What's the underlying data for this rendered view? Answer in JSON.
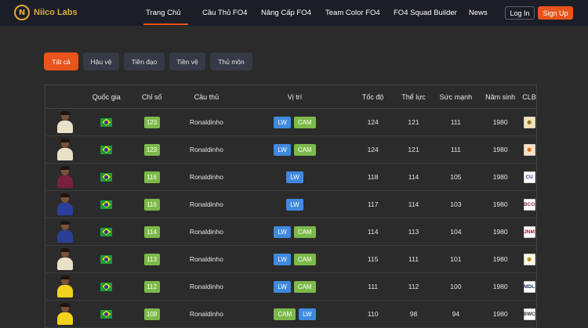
{
  "brand": {
    "logo_letter": "N",
    "name": "Niico Labs"
  },
  "nav": [
    {
      "label": "Trang Chủ",
      "active": true,
      "width": 51
    },
    {
      "label": "Cầu Thủ FO4",
      "active": false,
      "width": 54
    },
    {
      "label": "Nâng Cấp FO4",
      "active": false,
      "width": 61
    },
    {
      "label": "Team Color FO4",
      "active": false,
      "width": 66
    },
    {
      "label": "FO4 Squad Builder",
      "active": false,
      "width": 75
    },
    {
      "label": "News",
      "active": false,
      "width": 23
    }
  ],
  "auth": {
    "login": "Log In",
    "signup": "Sign Up"
  },
  "filters": [
    {
      "label": "Tất cả",
      "active": true,
      "width": 44
    },
    {
      "label": "Hậu vệ",
      "active": false,
      "width": 46
    },
    {
      "label": "Tiền đạo",
      "active": false,
      "width": 52
    },
    {
      "label": "Tiền vệ",
      "active": false,
      "width": 46
    },
    {
      "label": "Thủ môn",
      "active": false,
      "width": 54
    }
  ],
  "table": {
    "headers": [
      "",
      "Quốc gia",
      "Chỉ số",
      "Cầu thủ",
      "Vị trí",
      "Tốc độ",
      "Thể lực",
      "Sức mạnh",
      "Năm sinh",
      "CLB"
    ],
    "rows": [
      {
        "ovr": "123",
        "name": "Ronaldinho",
        "positions": [
          "LW",
          "CAM"
        ],
        "speed": "124",
        "stamina": "121",
        "strength": "111",
        "year": "1980",
        "club": "◉",
        "club_bg": "#f3e5b5",
        "club_color": "#8a6d1c",
        "kit": "#e8e0c8"
      },
      {
        "ovr": "123",
        "name": "Ronaldinho",
        "positions": [
          "LW",
          "CAM"
        ],
        "speed": "124",
        "stamina": "121",
        "strength": "111",
        "year": "1980",
        "club": "◉",
        "club_bg": "#fde0c2",
        "club_color": "#d9661a",
        "kit": "#e8e0c8"
      },
      {
        "ovr": "116",
        "name": "Ronaldinho",
        "positions": [
          "LW"
        ],
        "speed": "118",
        "stamina": "114",
        "strength": "105",
        "year": "1980",
        "club": "CU",
        "club_bg": "#ffffff",
        "club_color": "#4b2a8c",
        "kit": "#7a1f3d"
      },
      {
        "ovr": "116",
        "name": "Ronaldinho",
        "positions": [
          "LW"
        ],
        "speed": "117",
        "stamina": "114",
        "strength": "103",
        "year": "1980",
        "club": "BCO",
        "club_bg": "#ffffff",
        "club_color": "#7a1f3d",
        "kit": "#2a3f9a"
      },
      {
        "ovr": "114",
        "name": "Ronaldinho",
        "positions": [
          "LW",
          "CAM"
        ],
        "speed": "114",
        "stamina": "113",
        "strength": "104",
        "year": "1980",
        "club": "JNM",
        "club_bg": "#ffffff",
        "club_color": "#a01820",
        "kit": "#2a3f9a"
      },
      {
        "ovr": "113",
        "name": "Ronaldinho",
        "positions": [
          "LW",
          "CAM"
        ],
        "speed": "115",
        "stamina": "111",
        "strength": "101",
        "year": "1980",
        "club": "◉",
        "club_bg": "#fff8e0",
        "club_color": "#b08a1c",
        "kit": "#e8e0c8"
      },
      {
        "ovr": "112",
        "name": "Ronaldinho",
        "positions": [
          "LW",
          "CAM"
        ],
        "speed": "111",
        "stamina": "112",
        "strength": "100",
        "year": "1980",
        "club": "MDL",
        "club_bg": "#ffffff",
        "club_color": "#1a2b5c",
        "kit": "#f2d21c"
      },
      {
        "ovr": "108",
        "name": "Ronaldinho",
        "positions": [
          "CAM",
          "LW"
        ],
        "speed": "110",
        "stamina": "98",
        "strength": "94",
        "year": "1980",
        "club": "BWC",
        "club_bg": "#ffffff",
        "club_color": "#333333",
        "kit": "#f2d21c"
      }
    ]
  }
}
